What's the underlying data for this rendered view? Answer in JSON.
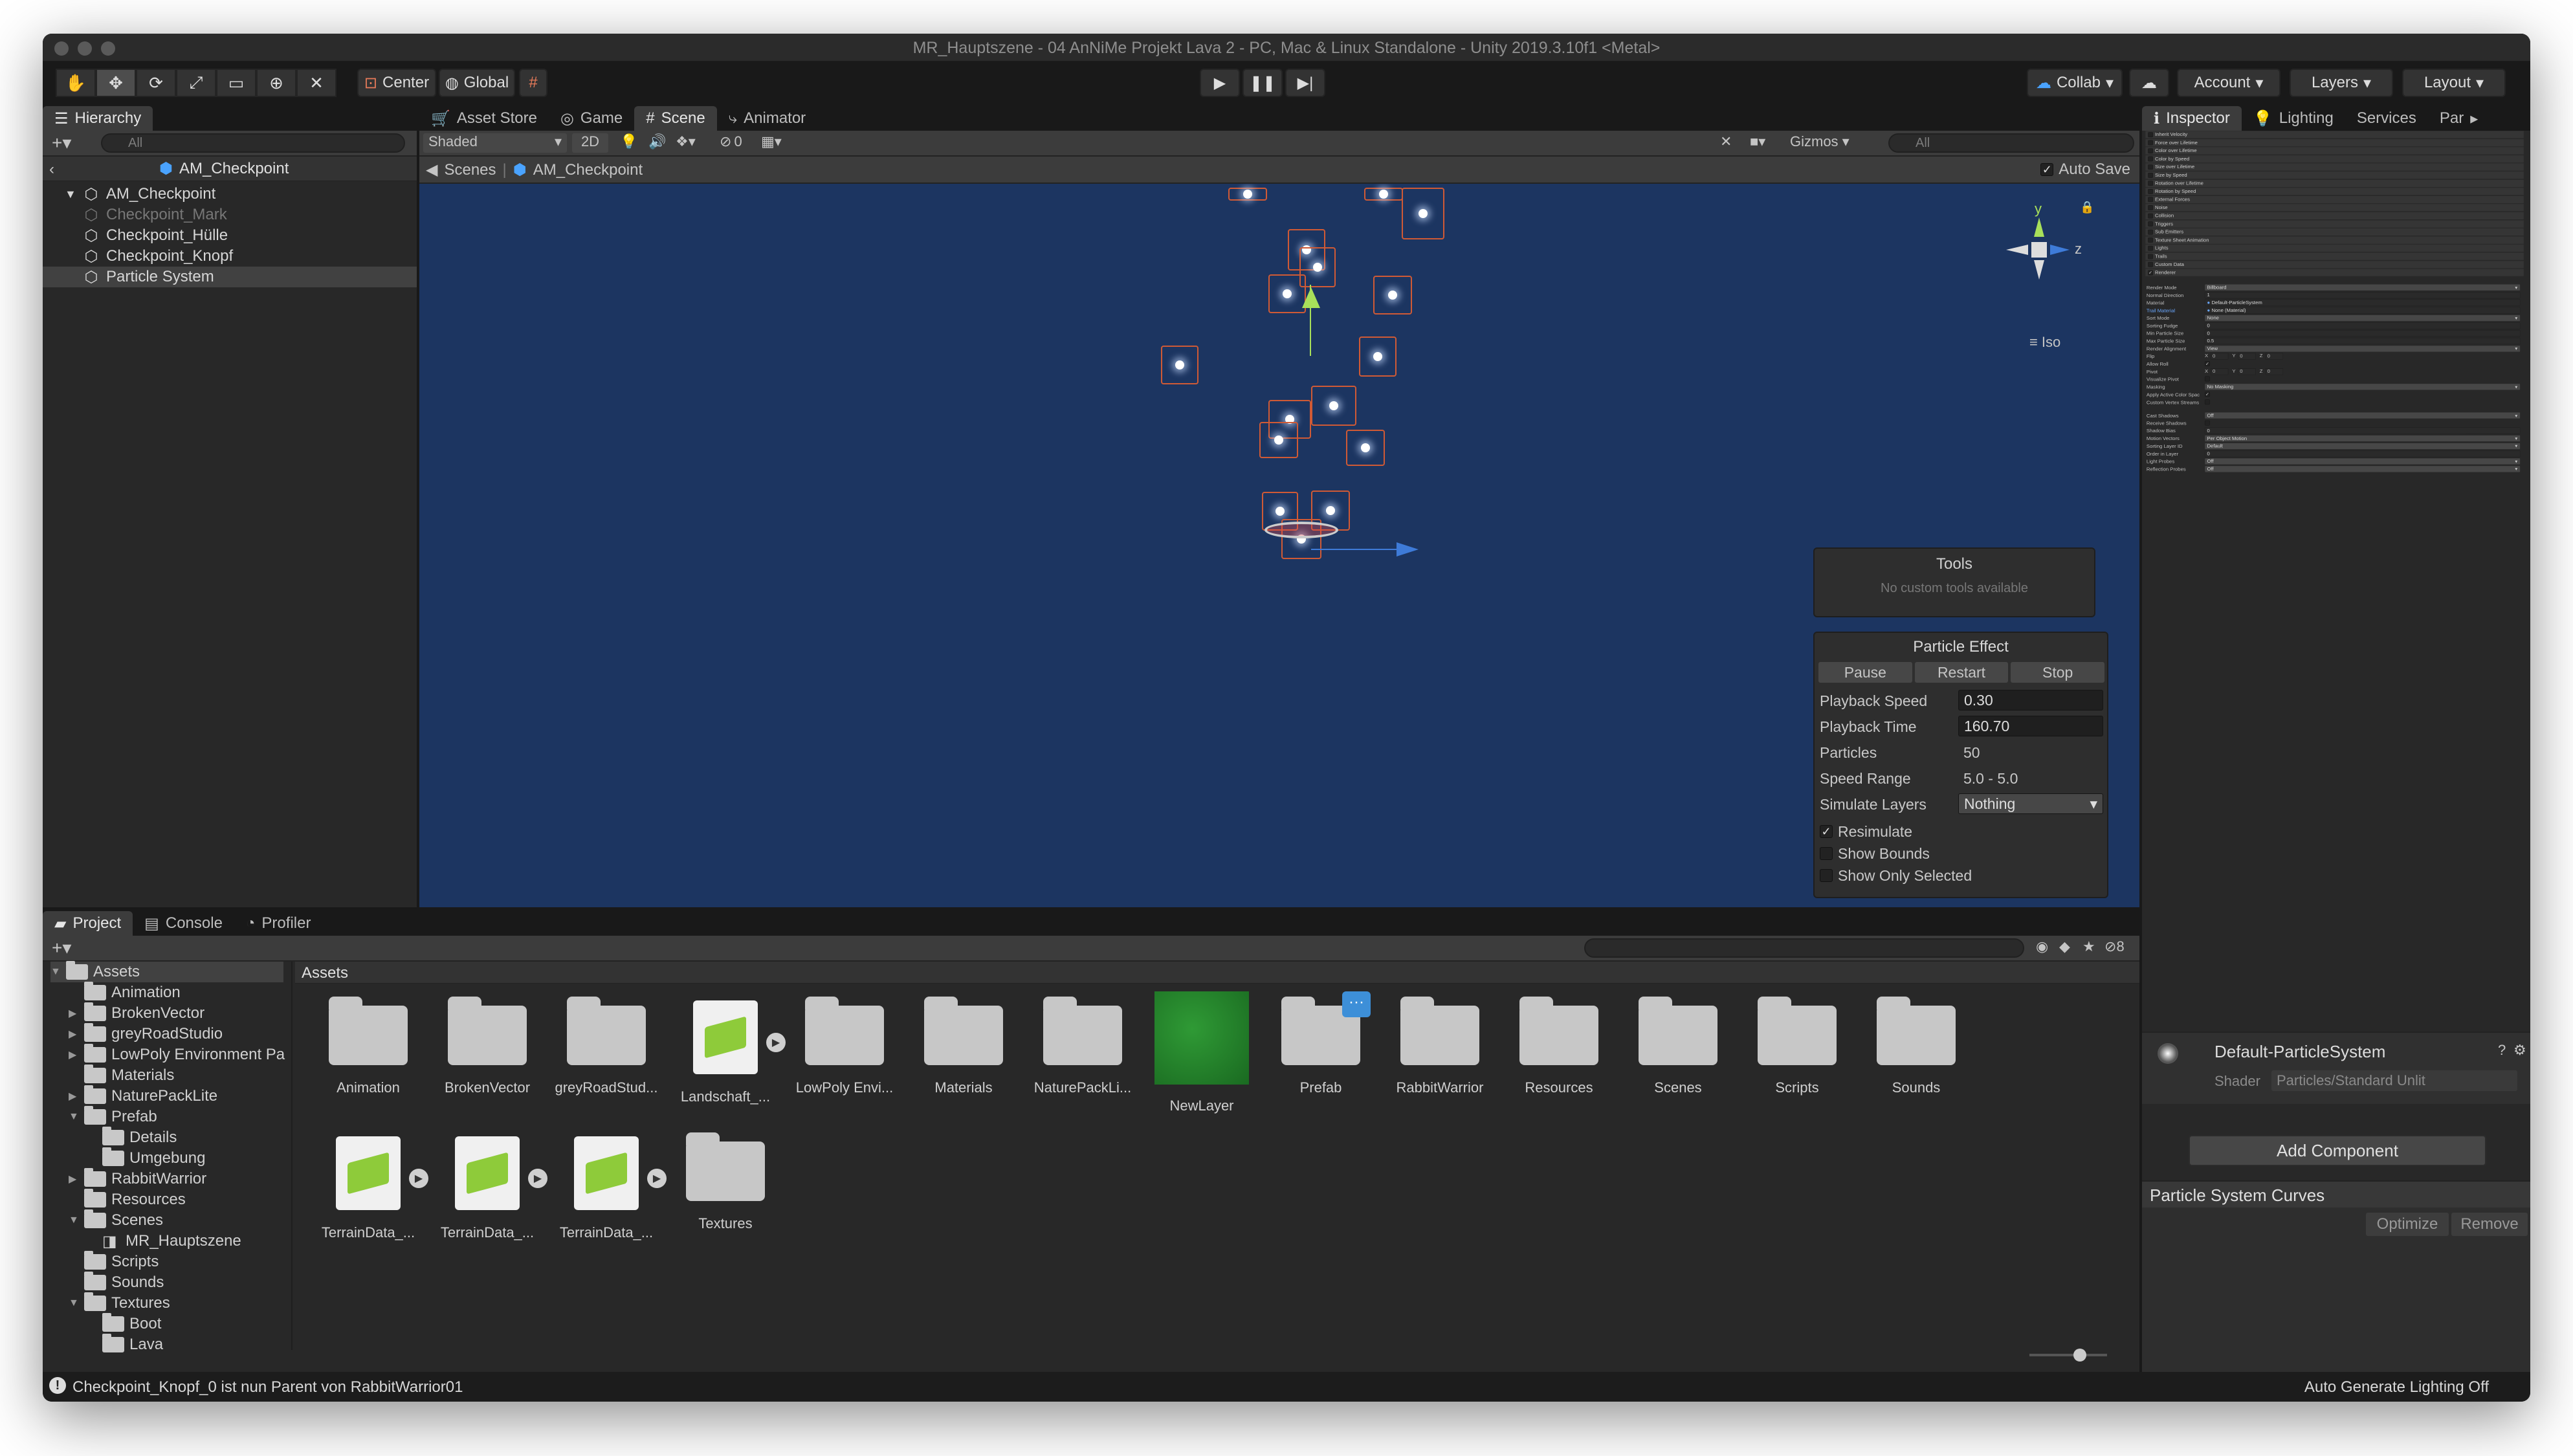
{
  "window": {
    "title": "MR_Hauptszene - 04 AnNiMe Projekt Lava 2 - PC, Mac & Linux Standalone - Unity 2019.3.10f1 <Metal>"
  },
  "toolbar": {
    "pivot": "Center",
    "space": "Global",
    "collab": "Collab",
    "account": "Account",
    "layers": "Layers",
    "layout": "Layout"
  },
  "hierarchy": {
    "tab": "Hierarchy",
    "search": "All",
    "scene": "AM_Checkpoint",
    "items": [
      {
        "label": "AM_Checkpoint",
        "depth": 0,
        "selected": false,
        "dim": false
      },
      {
        "label": "Checkpoint_Mark",
        "depth": 1,
        "selected": false,
        "dim": true
      },
      {
        "label": "Checkpoint_Hülle",
        "depth": 1,
        "selected": false,
        "dim": false
      },
      {
        "label": "Checkpoint_Knopf",
        "depth": 1,
        "selected": false,
        "dim": false
      },
      {
        "label": "Particle System",
        "depth": 1,
        "selected": true,
        "dim": false
      }
    ]
  },
  "scene": {
    "tabs": [
      "Asset Store",
      "Game",
      "Scene",
      "Animator"
    ],
    "active_tab": "Scene",
    "shading": "Shaded",
    "mode_2d": "2D",
    "hidden_count": "0",
    "gizmos": "Gizmos",
    "search": "All",
    "breadcrumb": [
      "Scenes",
      "AM_Checkpoint"
    ],
    "auto_save": "Auto Save",
    "iso": "Iso",
    "axis_y": "y",
    "axis_z": "z"
  },
  "tools_overlay": {
    "title": "Tools",
    "message": "No custom tools available"
  },
  "particle_effect": {
    "title": "Particle Effect",
    "buttons": [
      "Pause",
      "Restart",
      "Stop"
    ],
    "playback_speed_label": "Playback Speed",
    "playback_speed": "0.30",
    "playback_time_label": "Playback Time",
    "playback_time": "160.70",
    "particles_label": "Particles",
    "particles": "50",
    "speed_range_label": "Speed Range",
    "speed_range": "5.0 - 5.0",
    "simulate_layers_label": "Simulate Layers",
    "simulate_layers": "Nothing",
    "resimulate": "Resimulate",
    "show_bounds": "Show Bounds",
    "show_only_selected": "Show Only Selected"
  },
  "inspector": {
    "tabs": [
      "Inspector",
      "Lighting",
      "Services",
      "Par"
    ],
    "modules": [
      {
        "label": "Inherit Velocity",
        "checked": false
      },
      {
        "label": "Force over Lifetime",
        "checked": false
      },
      {
        "label": "Color over Lifetime",
        "checked": false
      },
      {
        "label": "Color by Speed",
        "checked": false
      },
      {
        "label": "Size over Lifetime",
        "checked": false
      },
      {
        "label": "Size by Speed",
        "checked": false
      },
      {
        "label": "Rotation over Lifetime",
        "checked": false
      },
      {
        "label": "Rotation by Speed",
        "checked": false
      },
      {
        "label": "External Forces",
        "checked": false
      },
      {
        "label": "Noise",
        "checked": false
      },
      {
        "label": "Collision",
        "checked": false
      },
      {
        "label": "Triggers",
        "checked": false
      },
      {
        "label": "Sub Emitters",
        "checked": false
      },
      {
        "label": "Texture Sheet Animation",
        "checked": false
      },
      {
        "label": "Lights",
        "checked": false
      },
      {
        "label": "Trails",
        "checked": false
      },
      {
        "label": "Custom Data",
        "checked": false
      },
      {
        "label": "Renderer",
        "checked": true
      }
    ],
    "renderer_props": [
      {
        "label": "Render Mode",
        "value": "Billboard",
        "type": "dropdown"
      },
      {
        "label": "Normal Direction",
        "value": "1",
        "type": "field"
      },
      {
        "label": "Material",
        "value": "Default-ParticleSystem",
        "type": "object"
      },
      {
        "label": "Trail Material",
        "value": "None (Material)",
        "type": "object",
        "highlight": true
      },
      {
        "label": "Sort Mode",
        "value": "None",
        "type": "dropdown"
      },
      {
        "label": "Sorting Fudge",
        "value": "0",
        "type": "field"
      },
      {
        "label": "Min Particle Size",
        "value": "0",
        "type": "field"
      },
      {
        "label": "Max Particle Size",
        "value": "0.5",
        "type": "field"
      },
      {
        "label": "Render Alignment",
        "value": "View",
        "type": "dropdown"
      },
      {
        "label": "Flip",
        "value": "",
        "type": "xyz",
        "x": "0",
        "y": "0",
        "z": "0"
      },
      {
        "label": "Allow Roll",
        "value": "",
        "type": "check",
        "checked": true
      },
      {
        "label": "Pivot",
        "value": "",
        "type": "xyz",
        "x": "0",
        "y": "0",
        "z": "0"
      },
      {
        "label": "Visualize Pivot",
        "value": "",
        "type": "check",
        "checked": false
      },
      {
        "label": "Masking",
        "value": "No Masking",
        "type": "dropdown"
      },
      {
        "label": "Apply Active Color Spac",
        "value": "",
        "type": "check",
        "checked": true
      },
      {
        "label": "Custom Vertex Streams",
        "value": "",
        "type": "check",
        "checked": false
      }
    ],
    "shadow_props": [
      {
        "label": "Cast Shadows",
        "value": "Off",
        "type": "dropdown"
      },
      {
        "label": "Receive Shadows",
        "value": "",
        "type": "check",
        "checked": false
      },
      {
        "label": "Shadow Bias",
        "value": "0",
        "type": "field"
      },
      {
        "label": "Motion Vectors",
        "value": "Per Object Motion",
        "type": "dropdown"
      },
      {
        "label": "Sorting Layer ID",
        "value": "Default",
        "type": "dropdown"
      },
      {
        "label": "Order in Layer",
        "value": "0",
        "type": "field"
      },
      {
        "label": "Light Probes",
        "value": "Off",
        "type": "dropdown"
      },
      {
        "label": "Reflection Probes",
        "value": "Off",
        "type": "dropdown"
      }
    ],
    "material_name": "Default-ParticleSystem",
    "shader_label": "Shader",
    "shader_value": "Particles/Standard Unlit",
    "add_component": "Add Component",
    "curves_title": "Particle System Curves",
    "optimize": "Optimize",
    "remove": "Remove"
  },
  "project": {
    "tabs": [
      "Project",
      "Console",
      "Profiler"
    ],
    "assets_header": "Assets",
    "hidden_count": "8",
    "tree": [
      {
        "label": "Assets",
        "depth": 0,
        "expanded": true,
        "selected": true
      },
      {
        "label": "Animation",
        "depth": 1
      },
      {
        "label": "BrokenVector",
        "depth": 1,
        "arrow": true
      },
      {
        "label": "greyRoadStudio",
        "depth": 1,
        "arrow": true
      },
      {
        "label": "LowPoly Environment Pa",
        "depth": 1,
        "arrow": true
      },
      {
        "label": "Materials",
        "depth": 1
      },
      {
        "label": "NaturePackLite",
        "depth": 1,
        "arrow": true
      },
      {
        "label": "Prefab",
        "depth": 1,
        "expanded": true
      },
      {
        "label": "Details",
        "depth": 2
      },
      {
        "label": "Umgebung",
        "depth": 2
      },
      {
        "label": "RabbitWarrior",
        "depth": 1,
        "arrow": true
      },
      {
        "label": "Resources",
        "depth": 1
      },
      {
        "label": "Scenes",
        "depth": 1,
        "expanded": true
      },
      {
        "label": "MR_Hauptszene",
        "depth": 2,
        "scene": true
      },
      {
        "label": "Scripts",
        "depth": 1
      },
      {
        "label": "Sounds",
        "depth": 1
      },
      {
        "label": "Textures",
        "depth": 1,
        "expanded": true
      },
      {
        "label": "Boot",
        "depth": 2
      },
      {
        "label": "Lava",
        "depth": 2
      }
    ],
    "assets": [
      {
        "label": "Animation",
        "kind": "folder"
      },
      {
        "label": "BrokenVector",
        "kind": "folder"
      },
      {
        "label": "greyRoadStud...",
        "kind": "folder"
      },
      {
        "label": "Landschaft_...",
        "kind": "terrain"
      },
      {
        "label": "LowPoly Envi...",
        "kind": "folder"
      },
      {
        "label": "Materials",
        "kind": "folder"
      },
      {
        "label": "NaturePackLi...",
        "kind": "folder"
      },
      {
        "label": "NewLayer",
        "kind": "layer"
      },
      {
        "label": "Prefab",
        "kind": "folder",
        "badge": "···"
      },
      {
        "label": "RabbitWarrior",
        "kind": "folder"
      },
      {
        "label": "Resources",
        "kind": "folder"
      },
      {
        "label": "Scenes",
        "kind": "folder"
      },
      {
        "label": "Scripts",
        "kind": "folder"
      },
      {
        "label": "Sounds",
        "kind": "folder"
      },
      {
        "label": "TerrainData_...",
        "kind": "terrain"
      },
      {
        "label": "TerrainData_...",
        "kind": "terrain"
      },
      {
        "label": "TerrainData_...",
        "kind": "terrain"
      },
      {
        "label": "Textures",
        "kind": "folder"
      }
    ]
  },
  "status": {
    "message": "Checkpoint_Knopf_0 ist nun Parent von RabbitWarrior01",
    "lighting": "Auto Generate Lighting Off"
  }
}
